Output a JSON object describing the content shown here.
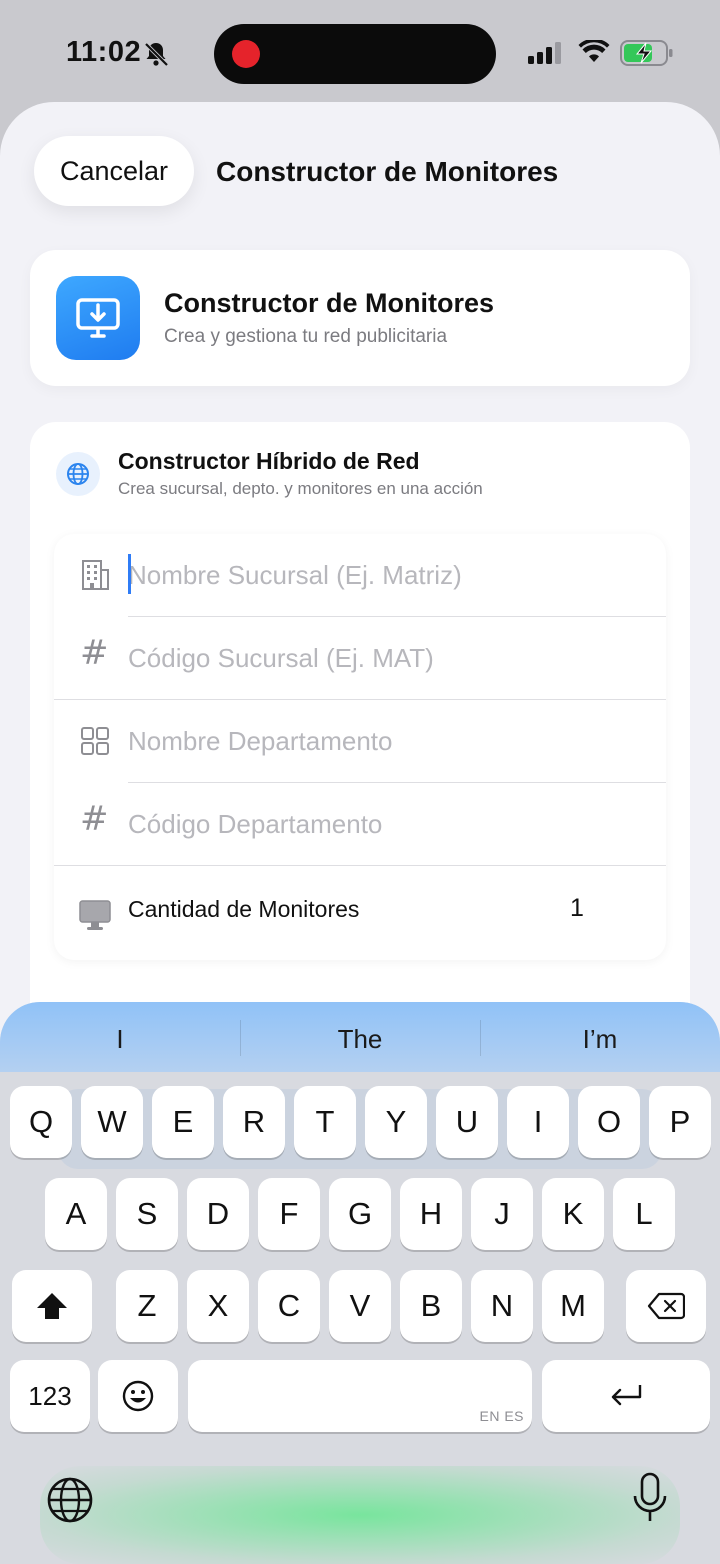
{
  "status": {
    "time": "11:02"
  },
  "nav": {
    "cancel_label": "Cancelar",
    "title": "Constructor de Monitores"
  },
  "header": {
    "title": "Constructor de Monitores",
    "subtitle": "Crea y gestiona tu red publicitaria"
  },
  "section": {
    "title": "Constructor Híbrido de Red",
    "subtitle": "Crea sucursal, depto. y monitores en una acción"
  },
  "fields": {
    "branch_name": {
      "placeholder": "Nombre Sucursal (Ej. Matriz)",
      "value": ""
    },
    "branch_code": {
      "placeholder": "Código Sucursal (Ej. MAT)",
      "value": ""
    },
    "dept_name": {
      "placeholder": "Nombre Departamento",
      "value": ""
    },
    "dept_code": {
      "placeholder": "Código Departamento",
      "value": ""
    },
    "monitor_count": {
      "label": "Cantidad de Monitores",
      "value": "1"
    }
  },
  "keyboard": {
    "suggestions": [
      "I",
      "The",
      "I’m"
    ],
    "row1": [
      "Q",
      "W",
      "E",
      "R",
      "T",
      "Y",
      "U",
      "I",
      "O",
      "P"
    ],
    "row2": [
      "A",
      "S",
      "D",
      "F",
      "G",
      "H",
      "J",
      "K",
      "L"
    ],
    "row3": [
      "Z",
      "X",
      "C",
      "V",
      "B",
      "N",
      "M"
    ],
    "numbers_label": "123",
    "lang_tag": "EN ES"
  },
  "colors": {
    "accent": "#2b84ee",
    "icon_gradient_start": "#3ea8ff",
    "icon_gradient_end": "#1f7cf0",
    "record": "#e5232b",
    "battery": "#34c759"
  }
}
